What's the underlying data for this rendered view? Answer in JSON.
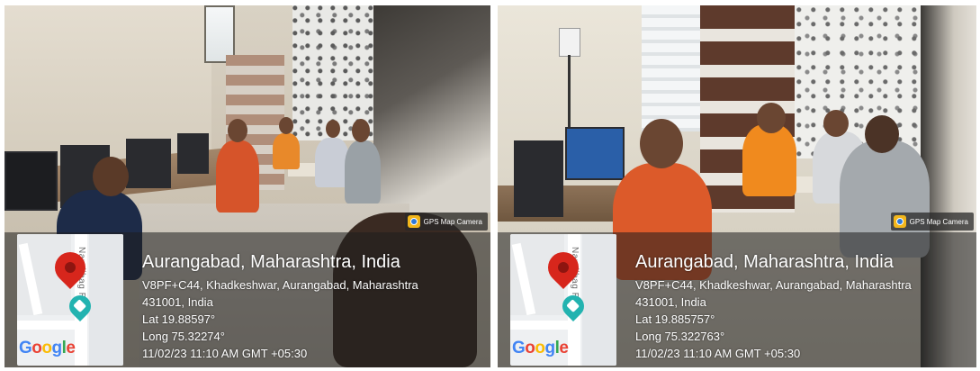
{
  "photos": [
    {
      "badge": "GPS Map Camera",
      "map_road_label": "Naralibag Rd",
      "map_logo": "Google",
      "title": "Aurangabad, Maharashtra, India",
      "address": "V8PF+C44, Khadkeshwar, Aurangabad, Maharashtra",
      "postal": "431001, India",
      "lat": "Lat 19.88597°",
      "long": "Long 75.32274°",
      "datetime": "11/02/23 11:10 AM GMT +05:30"
    },
    {
      "badge": "GPS Map Camera",
      "map_road_label": "Naralibag Rd",
      "map_logo": "Google",
      "title": "Aurangabad, Maharashtra, India",
      "address": "V8PF+C44, Khadkeshwar, Aurangabad, Maharashtra",
      "postal": "431001, India",
      "lat": "Lat 19.885757°",
      "long": "Long 75.322763°",
      "datetime": "11/02/23 11:10 AM GMT +05:30"
    }
  ],
  "icons": {
    "badge": "camera-app-icon",
    "pin": "red-location-pin-icon",
    "poi": "metro-station-icon"
  },
  "colors": {
    "pin": "#d7261c",
    "poi": "#23b3b0",
    "overlay_text": "#ffffff"
  }
}
